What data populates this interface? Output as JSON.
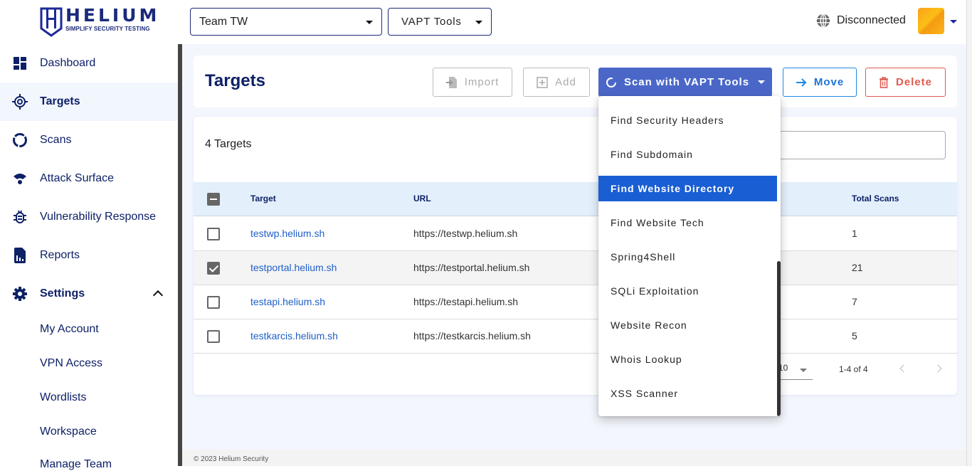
{
  "brand": {
    "name": "HELIUM",
    "tagline": "SIMPLIFY SECURITY TESTING",
    "color": "#1b2a7a"
  },
  "header": {
    "team_select": {
      "value": "Team TW"
    },
    "tool_select": {
      "value": "VAPT Tools"
    },
    "connection_status": "Disconnected",
    "connection_icon": "globe-icon"
  },
  "sidebar": {
    "items": [
      {
        "label": "Dashboard",
        "icon": "dashboard-icon"
      },
      {
        "label": "Targets",
        "icon": "target-icon",
        "active": true
      },
      {
        "label": "Scans",
        "icon": "scans-icon"
      },
      {
        "label": "Attack Surface",
        "icon": "attack-surface-icon"
      },
      {
        "label": "Vulnerability Response",
        "icon": "bug-icon"
      },
      {
        "label": "Reports",
        "icon": "report-icon"
      },
      {
        "label": "Settings",
        "icon": "gear-icon",
        "expanded": true
      }
    ],
    "settings_sub": [
      "My Account",
      "VPN Access",
      "Wordlists",
      "Workspace",
      "Manage Team"
    ]
  },
  "page": {
    "title": "Targets",
    "buttons": {
      "import": "Import",
      "add": "Add",
      "scan": "Scan with VAPT Tools",
      "move": "Move",
      "delete": "Delete"
    },
    "colors": {
      "scan_bg": "#4a67c8",
      "move": "#1e73d6",
      "delete": "#e05a4f",
      "menu_highlight": "#1a5ed3"
    }
  },
  "table": {
    "count_label": "4 Targets",
    "columns": [
      "Target",
      "URL",
      "Total Scans"
    ],
    "rows": [
      {
        "target": "testwp.helium.sh",
        "url": "https://testwp.helium.sh",
        "total_scans": "1",
        "checked": false
      },
      {
        "target": "testportal.helium.sh",
        "url": "https://testportal.helium.sh",
        "total_scans": "21",
        "checked": true
      },
      {
        "target": "testapi.helium.sh",
        "url": "https://testapi.helium.sh",
        "total_scans": "7",
        "checked": false
      },
      {
        "target": "testkarcis.helium.sh",
        "url": "https://testkarcis.helium.sh",
        "total_scans": "5",
        "checked": false
      }
    ],
    "pagination": {
      "rows_per_page": "10",
      "range": "1-4 of 4"
    }
  },
  "scan_menu": {
    "items": [
      "Find Security Headers",
      "Find Subdomain",
      "Find Website Directory",
      "Find Website Tech",
      "Spring4Shell",
      "SQLi Exploitation",
      "Website Recon",
      "Whois Lookup",
      "XSS Scanner"
    ],
    "highlighted": "Find Website Directory"
  },
  "footer": {
    "copyright": "© 2023 Helium Security"
  }
}
